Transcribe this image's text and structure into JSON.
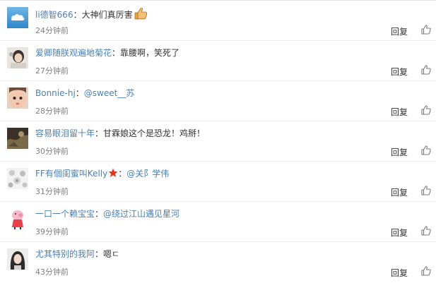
{
  "reply_label": "回复",
  "comments": [
    {
      "user": "li德智666",
      "sep": "：",
      "text": "大神们真厉害",
      "time": "24分钟前",
      "avatar": "cloud-avatar"
    },
    {
      "user": "爱卿随朕观遍地菊花",
      "sep": "：",
      "text": "靠腰啊，笑死了",
      "time": "27分钟前",
      "avatar": "girl-avatar"
    },
    {
      "user": "Bonnie-hj",
      "sep": "：",
      "mention": "@sweet__苏",
      "time": "28分钟前",
      "avatar": "baby-avatar"
    },
    {
      "user": "容易眼泪留十年",
      "sep": "：",
      "text": "甘霖娘这个是恐龙！鸡掰！",
      "time": "30分钟前",
      "avatar": "dark-avatar"
    },
    {
      "user": "FF有個闺蜜叫Kelly",
      "sep": "：",
      "mention": "@关阝学伟",
      "time": "31分钟前",
      "avatar": "pattern-avatar"
    },
    {
      "user": "一口一个赖宝宝",
      "sep": "：",
      "mention": "@绕过江山遇见星河",
      "time": "39分钟前",
      "avatar": "pig-avatar"
    },
    {
      "user": "尤其特别的我阿",
      "sep": "：",
      "text": "嗯ㄷ",
      "time": "43分钟前",
      "avatar": "woman-avatar"
    }
  ],
  "colors": {
    "link": "#4a7fb5",
    "time": "#808080",
    "text": "#333333",
    "divider": "#ececec"
  },
  "icons": [
    "like-thumb-icon",
    "thumbs-up-emoji-icon",
    "red-star-icon"
  ]
}
